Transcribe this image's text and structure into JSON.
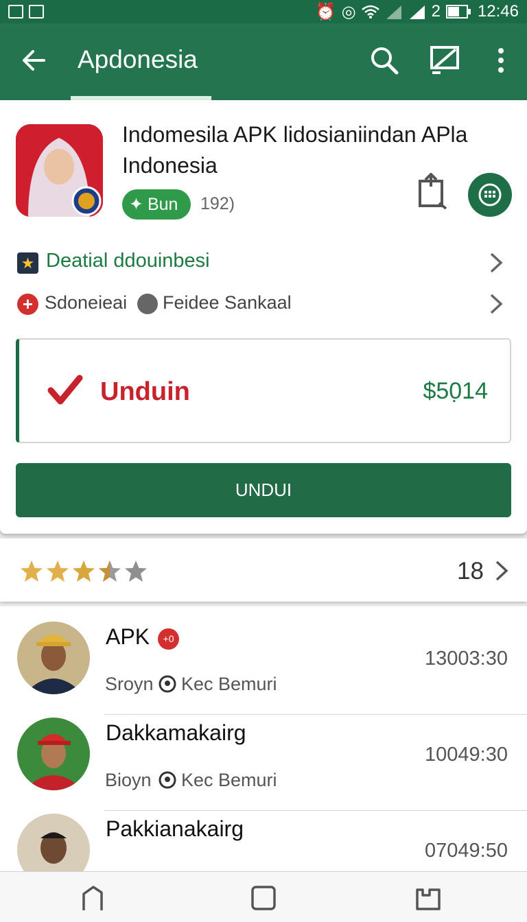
{
  "status_bar": {
    "battery_text": "2",
    "time": "12:46"
  },
  "app_bar": {
    "title": "Apdonesia",
    "icons": [
      "back-arrow-icon",
      "search-icon",
      "edit-icon",
      "more-vert-icon"
    ]
  },
  "app": {
    "title": "Indomesila APK lidosianiindan APla Indonesia",
    "badge_label": "Bun",
    "review_count": "192)",
    "detail_label": "Deatial ddouinbesi",
    "meta_1": "Sdoneieai",
    "meta_2": "Feidee Sankaal"
  },
  "price_box": {
    "label": "Unduin",
    "price": "$50̣14"
  },
  "download_button": "UNDUI",
  "rating": {
    "stars": 3.5,
    "count": "18"
  },
  "list": [
    {
      "name": "APK",
      "badge": "+0",
      "sub1": "Sroyn",
      "sub2": "Kec Bemuri",
      "time": "13003:30"
    },
    {
      "name": "Dakkamakairg",
      "sub1": "Bioyn",
      "sub2": "Kec Bemuri",
      "time": "10049:30"
    },
    {
      "name": "Pakkianakairg",
      "time": "07049:50"
    }
  ],
  "colors": {
    "primary": "#23744f",
    "status_bar": "#1c6b47",
    "accent_red": "#c8232c",
    "badge_green": "#2e9a4a"
  }
}
